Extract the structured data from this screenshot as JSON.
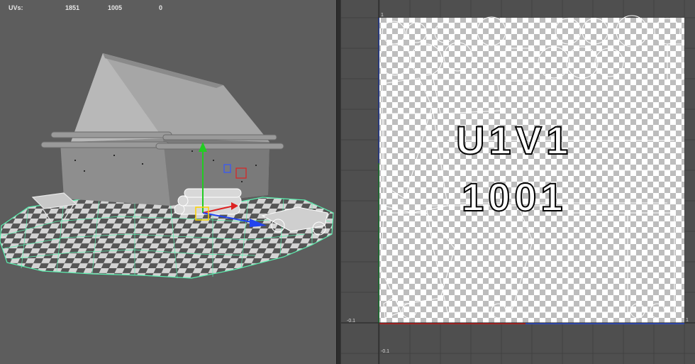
{
  "hud": {
    "label": "UVs:",
    "col1": "1851",
    "col2": "1005",
    "col3": "0"
  },
  "uv_editor": {
    "tile_text_line1": "U1V1",
    "tile_text_line2": "1001",
    "axis_label_top": "1",
    "axis_label_left": "-0.1",
    "axis_label_bottom": "-0.1",
    "axis_label_right": "1"
  },
  "colors": {
    "viewport_bg": "#5d5d5d",
    "uv_bg": "#4f4f4f",
    "gizmo_y": "#22cc22",
    "gizmo_x": "#dd2222",
    "gizmo_z": "#2244ee",
    "wire_selected": "#5cf0b0",
    "uv_axis_u": "#c02020",
    "uv_axis_v": "#3050d0"
  },
  "icons": [
    "move-manipulator-icon"
  ]
}
